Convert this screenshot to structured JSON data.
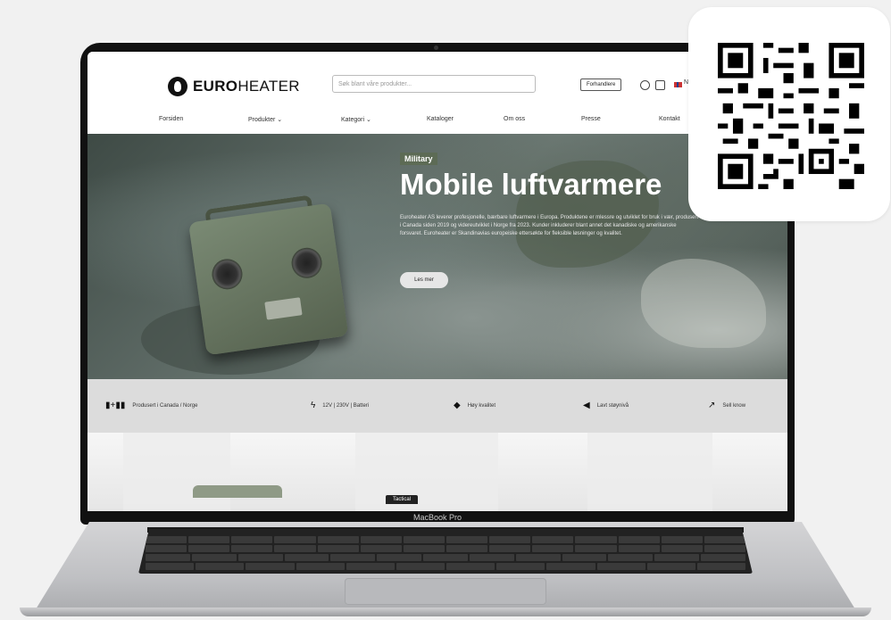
{
  "site": {
    "logo_bold": "EURO",
    "logo_light": "HEATER",
    "search_placeholder": "Søk blant våre produkter...",
    "trade_button": "Forhandlere",
    "language": "NO"
  },
  "nav": {
    "items": [
      "Forsiden",
      "Produkter ⌄",
      "Kategori ⌄",
      "Kataloger",
      "Om oss",
      "Presse",
      "Kontakt"
    ]
  },
  "hero": {
    "tag": "Military",
    "title": "Mobile luftvarmere",
    "text": "Euroheater AS leverer profesjonelle, bærbare luftvarmere i Europa. Produktene er mlessre og utviklet for bruk i vær, produsert i Canada siden 2019 og videreutviklet i Norge fra 2023. Kunder inkluderer blant annet det kanadiske og amerikanske forsvaret. Euroheater er Skandinavias europeiske ettersøkte for fleksible løsninger og kvalitet.",
    "button": "Les mer"
  },
  "features": [
    {
      "icon": "flags-icon",
      "glyph": "▮+▮▮",
      "label": "Produsert i Canada / Norge"
    },
    {
      "icon": "bolt-icon",
      "glyph": "ϟ",
      "label": "12V | 230V | Batteri"
    },
    {
      "icon": "diamond-icon",
      "glyph": "◆",
      "label": "Høy kvalitet"
    },
    {
      "icon": "speaker-icon",
      "glyph": "◀",
      "label": "Lavt støynivå"
    },
    {
      "icon": "tool-icon",
      "glyph": "↗",
      "label": "Sell know"
    }
  ],
  "lower": {
    "tab": "Tactical"
  },
  "device": {
    "label": "MacBook Pro"
  },
  "colors": {
    "background": "#f1f1f1",
    "hero_tag": "#5d6b55",
    "bezel": "#111111"
  }
}
